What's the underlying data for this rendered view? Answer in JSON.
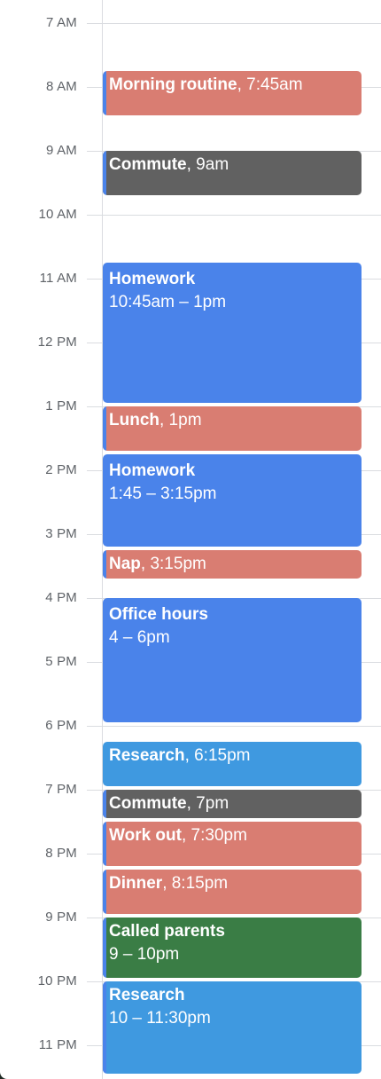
{
  "hours": [
    {
      "label": "7 AM"
    },
    {
      "label": "8 AM"
    },
    {
      "label": "9 AM"
    },
    {
      "label": "10 AM"
    },
    {
      "label": "11 AM"
    },
    {
      "label": "12 PM"
    },
    {
      "label": "1 PM"
    },
    {
      "label": "2 PM"
    },
    {
      "label": "3 PM"
    },
    {
      "label": "4 PM"
    },
    {
      "label": "5 PM"
    },
    {
      "label": "6 PM"
    },
    {
      "label": "7 PM"
    },
    {
      "label": "8 PM"
    },
    {
      "label": "9 PM"
    },
    {
      "label": "10 PM"
    },
    {
      "label": "11 PM"
    }
  ],
  "colors": {
    "salmon": "#d97d72",
    "graphite": "#616161",
    "blue": "#4a83ea",
    "sky": "#3f99e0",
    "green": "#3a7d45",
    "accent": "#4a83ea"
  },
  "events": [
    {
      "title": "Morning routine",
      "time": ", 7:45am"
    },
    {
      "title": "Commute",
      "time": ", 9am"
    },
    {
      "title": "Homework",
      "time": "10:45am – 1pm"
    },
    {
      "title": "Lunch",
      "time": ", 1pm"
    },
    {
      "title": "Homework",
      "time": "1:45 – 3:15pm"
    },
    {
      "title": "Nap",
      "time": ", 3:15pm"
    },
    {
      "title": "Office hours",
      "time": "4 – 6pm"
    },
    {
      "title": "Research",
      "time": ", 6:15pm"
    },
    {
      "title": "Commute",
      "time": ", 7pm"
    },
    {
      "title": "Work out",
      "time": ", 7:30pm"
    },
    {
      "title": "Dinner",
      "time": ", 8:15pm"
    },
    {
      "title": "Called parents",
      "time": "9 – 10pm"
    },
    {
      "title": "Research",
      "time": "10 – 11:30pm"
    }
  ]
}
